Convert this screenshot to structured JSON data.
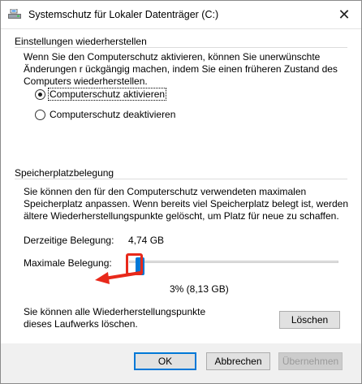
{
  "window": {
    "title": "Systemschutz für Lokaler Datenträger (C:)",
    "icon": "drive-protect-icon",
    "close_glyph": "✕"
  },
  "restore": {
    "heading": "Einstellungen wiederherstellen",
    "description": "Wenn Sie den Computerschutz aktivieren, können Sie unerwünschte Änderungen r ückgängig machen, indem Sie einen früheren Zustand des Computers wiederherstellen.",
    "options": [
      {
        "label": "Computerschutz aktivieren",
        "checked": true
      },
      {
        "label": "Computerschutz deaktivieren",
        "checked": false
      }
    ]
  },
  "storage": {
    "heading": "Speicherplatzbelegung",
    "description": "Sie können den für den Computerschutz verwendeten maximalen Speicherplatz anpassen. Wenn bereits viel Speicherplatz belegt ist, werden ältere Wiederherstellungspunkte gelöscht, um Platz für neue zu schaffen.",
    "current_label": "Derzeitige Belegung:",
    "current_value": "4,74 GB",
    "max_label": "Maximale Belegung:",
    "max_fraction": 0.03,
    "max_value": "3% (8,13 GB)",
    "delete_text": "Sie können alle Wiederherstellungspunkte dieses Laufwerks löschen.",
    "delete_button": "Löschen"
  },
  "footer": {
    "ok": "OK",
    "cancel": "Abbrechen",
    "apply": "Übernehmen"
  },
  "colors": {
    "accent": "#0078d7",
    "highlight": "#e8291b"
  }
}
